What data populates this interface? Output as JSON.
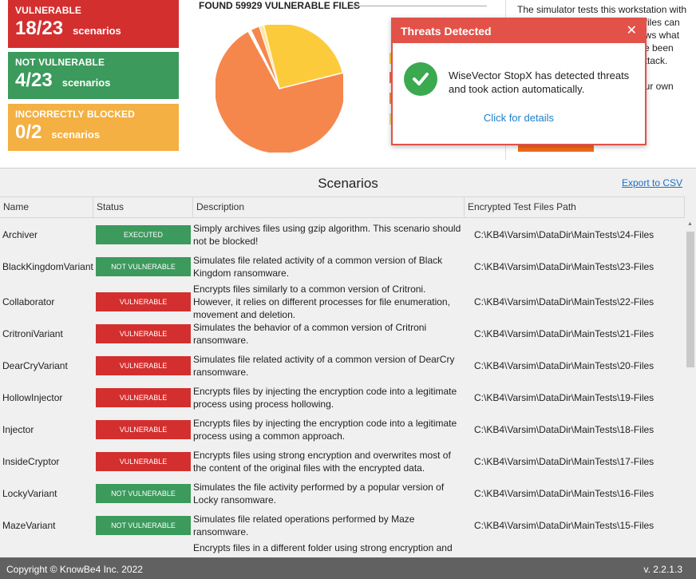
{
  "summary": {
    "vulnerable": {
      "title": "VULNERABLE",
      "count": "18/23",
      "unit": "scenarios",
      "color": "#d32f2f"
    },
    "not_vulnerable": {
      "title": "NOT VULNERABLE",
      "count": "4/23",
      "unit": "scenarios",
      "color": "#3b9a5c"
    },
    "incorrectly_blocked": {
      "title": "INCORRECTLY BLOCKED",
      "count": "0/2",
      "unit": "scenarios",
      "color": "#f4b042"
    }
  },
  "found_heading": "FOUND 59929 VULNERABLE FILES",
  "side_text": {
    "line1": "The simulator tests this workstation with",
    "line2": "f files can",
    "line3": "ows what",
    "line4": "ve been",
    "line5": "attack.",
    "line6": "our own"
  },
  "popup": {
    "title": "Threats Detected",
    "close_glyph": "✕",
    "message": "WiseVector StopX has detected threats and took action automatically.",
    "link": "Click for details"
  },
  "scenarios": {
    "title": "Scenarios",
    "export_label": "Export to CSV",
    "columns": [
      "Name",
      "Status",
      "Description",
      "Encrypted Test Files Path"
    ],
    "rows": [
      {
        "name": "Archiver",
        "status": "EXECUTED",
        "description": "Simply archives files using gzip algorithm. This scenario should not be blocked!",
        "path": "C:\\KB4\\Varsim\\DataDir\\MainTests\\24-Files"
      },
      {
        "name": "BlackKingdomVariant",
        "status": "NOT VULNERABLE",
        "description": "Simulates file related activity of a common version of Black Kingdom ransomware.",
        "path": "C:\\KB4\\Varsim\\DataDir\\MainTests\\23-Files"
      },
      {
        "name": "Collaborator",
        "status": "VULNERABLE",
        "description": "Encrypts files similarly to a common version of Critroni. However, it relies on different processes for file enumeration, movement and deletion.",
        "path": "C:\\KB4\\Varsim\\DataDir\\MainTests\\22-Files"
      },
      {
        "name": "CritroniVariant",
        "status": "VULNERABLE",
        "description": "Simulates the behavior of a common version of Critroni ransomware.",
        "path": "C:\\KB4\\Varsim\\DataDir\\MainTests\\21-Files"
      },
      {
        "name": "DearCryVariant",
        "status": "VULNERABLE",
        "description": "Simulates file related activity of a common version of DearCry ransomware.",
        "path": "C:\\KB4\\Varsim\\DataDir\\MainTests\\20-Files"
      },
      {
        "name": "HollowInjector",
        "status": "VULNERABLE",
        "description": "Encrypts files by injecting the encryption code into a legitimate process using process hollowing.",
        "path": "C:\\KB4\\Varsim\\DataDir\\MainTests\\19-Files"
      },
      {
        "name": "Injector",
        "status": "VULNERABLE",
        "description": "Encrypts files by injecting the encryption code into a legitimate process using a common approach.",
        "path": "C:\\KB4\\Varsim\\DataDir\\MainTests\\18-Files"
      },
      {
        "name": "InsideCryptor",
        "status": "VULNERABLE",
        "description": "Encrypts files using strong encryption and overwrites most of the content of the original files with the encrypted data.",
        "path": "C:\\KB4\\Varsim\\DataDir\\MainTests\\17-Files"
      },
      {
        "name": "LockyVariant",
        "status": "NOT VULNERABLE",
        "description": "Simulates the file activity performed by a popular version of Locky ransomware.",
        "path": "C:\\KB4\\Varsim\\DataDir\\MainTests\\16-Files"
      },
      {
        "name": "MazeVariant",
        "status": "NOT VULNERABLE",
        "description": "Simulates file related operations performed by Maze ransomware.",
        "path": "C:\\KB4\\Varsim\\DataDir\\MainTests\\15-Files"
      },
      {
        "name": "",
        "status": "",
        "description": "Encrypts files in a different folder using strong encryption and",
        "path": ""
      }
    ]
  },
  "pie_colors": {
    "vulnerable": "#f5874d",
    "other": "#fccb3c",
    "thin": "#fde8a8"
  },
  "footer": {
    "copyright": "Copyright © KnowBe4 Inc. 2022",
    "version": "v. 2.2.1.3"
  }
}
